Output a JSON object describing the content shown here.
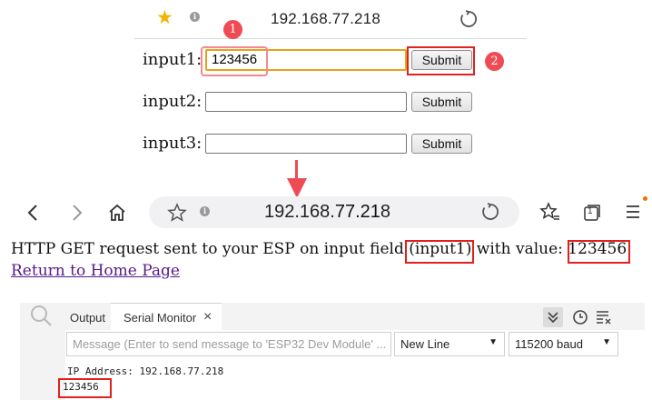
{
  "top_browser": {
    "url": "192.168.77.218",
    "info_glyph": "i"
  },
  "form": {
    "rows": [
      {
        "label": "input1:",
        "value": "123456",
        "button": "Submit"
      },
      {
        "label": "input2:",
        "value": "",
        "button": "Submit"
      },
      {
        "label": "input3:",
        "value": "",
        "button": "Submit"
      }
    ]
  },
  "annotations": {
    "step1": "1",
    "step2": "2",
    "accent_color": "#ef4b55",
    "box_color": "#e0211d"
  },
  "browser": {
    "url_prefix": "192.168.",
    "url_bold": "77.21",
    "url_suffix": "8",
    "info_glyph": "i",
    "tab_count": "1"
  },
  "result": {
    "text_before": "HTTP GET request sent to your ESP on input field ",
    "field": "(input1)",
    "text_middle": " with value: ",
    "value": "123456",
    "link": "Return to Home Page"
  },
  "serial_monitor": {
    "tabs": [
      "Output",
      "Serial Monitor"
    ],
    "close_glyph": "×",
    "message_placeholder": "Message (Enter to send message to 'ESP32 Dev Module' ...",
    "line_ending": "New Line",
    "baud": "115200 baud",
    "lines": [
      "IP Address: 192.168.77.218",
      "123456"
    ]
  }
}
